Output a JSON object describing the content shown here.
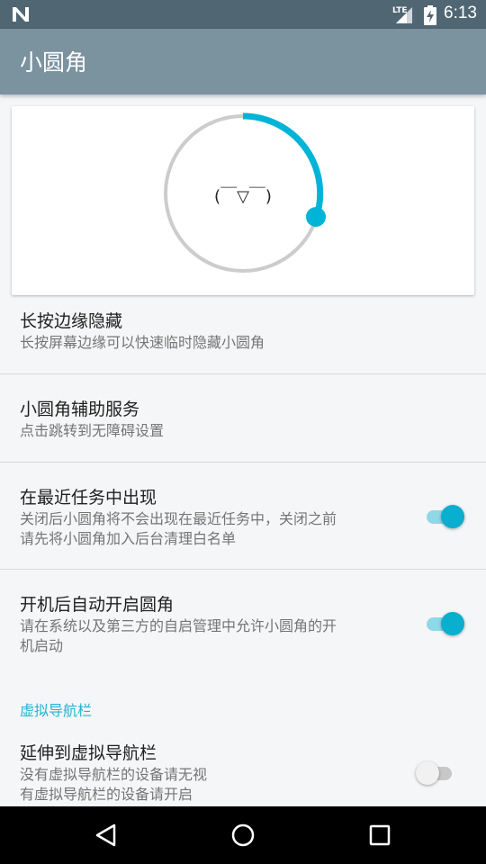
{
  "status_bar": {
    "network": "LTE",
    "time": "6:13"
  },
  "app_bar": {
    "title": "小圆角"
  },
  "preview": {
    "face": "(￣▽￣)",
    "accent_color": "#00b4d8",
    "ring_color": "#cccccc"
  },
  "settings": [
    {
      "title": "长按边缘隐藏",
      "summary_lines": [
        "长按屏幕边缘可以快速临时隐藏小圆角"
      ]
    },
    {
      "title": "小圆角辅助服务",
      "summary_lines": [
        "点击跳转到无障碍设置"
      ]
    },
    {
      "title": "在最近任务中出现",
      "summary_lines": [
        "关闭后小圆角将不会出现在最近任务中，关闭之前",
        "请先将小圆角加入后台清理白名单"
      ],
      "switch_on": true
    },
    {
      "title": "开机后自动开启圆角",
      "summary_lines": [
        "请在系统以及第三方的自启管理中允许小圆角的开",
        "机启动"
      ],
      "switch_on": true
    }
  ],
  "section_header": "虚拟导航栏",
  "nav_setting": {
    "title": "延伸到虚拟导航栏",
    "summary_lines": [
      "没有虚拟导航栏的设备请无视",
      "有虚拟导航栏的设备请开启"
    ],
    "switch_on": false
  },
  "colors": {
    "status_bar": "#516673",
    "app_bar": "#7b929f",
    "accent": "#26b2d1"
  }
}
